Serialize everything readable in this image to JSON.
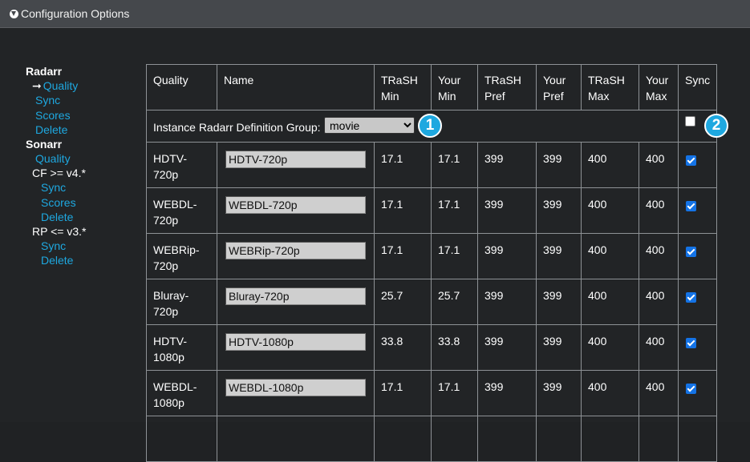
{
  "header": {
    "title": "Configuration Options",
    "icon": "circle-arrow-down-icon"
  },
  "sidebar": {
    "radarr": {
      "label": "Radarr",
      "items": [
        "Quality",
        "Sync",
        "Scores",
        "Delete"
      ],
      "current_marker": "➞"
    },
    "sonarr": {
      "label": "Sonarr",
      "items": [
        "Quality"
      ],
      "cf": {
        "label": "CF >= v4.*",
        "items": [
          "Sync",
          "Scores",
          "Delete"
        ]
      },
      "rp": {
        "label": "RP <= v3.*",
        "items": [
          "Sync",
          "Delete"
        ]
      }
    }
  },
  "table": {
    "headers": [
      {
        "l1": "Quality",
        "l2": ""
      },
      {
        "l1": "Name",
        "l2": ""
      },
      {
        "l1": "TRaSH",
        "l2": "Min"
      },
      {
        "l1": "Your",
        "l2": "Min"
      },
      {
        "l1": "TRaSH",
        "l2": "Pref"
      },
      {
        "l1": "Your",
        "l2": "Pref"
      },
      {
        "l1": "TRaSH",
        "l2": "Max"
      },
      {
        "l1": "Your",
        "l2": "Max"
      },
      {
        "l1": "Sync",
        "l2": ""
      }
    ],
    "group_label": "Instance Radarr Definition Group:",
    "group_value": "movie",
    "badge1": "1",
    "badge2": "2",
    "group_sync_checked": false,
    "rows": [
      {
        "q1": "HDTV-",
        "q2": "720p",
        "name": "HDTV-720p",
        "tmin": "17.1",
        "ymin": "17.1",
        "tpref": "399",
        "ypref": "399",
        "tmax": "400",
        "ymax": "400",
        "sync": true
      },
      {
        "q1": "WEBDL-",
        "q2": "720p",
        "name": "WEBDL-720p",
        "tmin": "17.1",
        "ymin": "17.1",
        "tpref": "399",
        "ypref": "399",
        "tmax": "400",
        "ymax": "400",
        "sync": true
      },
      {
        "q1": "WEBRip-",
        "q2": "720p",
        "name": "WEBRip-720p",
        "tmin": "17.1",
        "ymin": "17.1",
        "tpref": "399",
        "ypref": "399",
        "tmax": "400",
        "ymax": "400",
        "sync": true
      },
      {
        "q1": "Bluray-",
        "q2": "720p",
        "name": "Bluray-720p",
        "tmin": "25.7",
        "ymin": "25.7",
        "tpref": "399",
        "ypref": "399",
        "tmax": "400",
        "ymax": "400",
        "sync": true
      },
      {
        "q1": "HDTV-",
        "q2": "1080p",
        "name": "HDTV-1080p",
        "tmin": "33.8",
        "ymin": "33.8",
        "tpref": "399",
        "ypref": "399",
        "tmax": "400",
        "ymax": "400",
        "sync": true
      },
      {
        "q1": "WEBDL-",
        "q2": "1080p",
        "name": "WEBDL-1080p",
        "tmin": "17.1",
        "ymin": "17.1",
        "tpref": "399",
        "ypref": "399",
        "tmax": "400",
        "ymax": "400",
        "sync": true
      }
    ]
  },
  "colors": {
    "accent": "#1ea8e0",
    "checkbox": "#1473e6",
    "background": "#222426",
    "header_bar": "#45484c"
  }
}
